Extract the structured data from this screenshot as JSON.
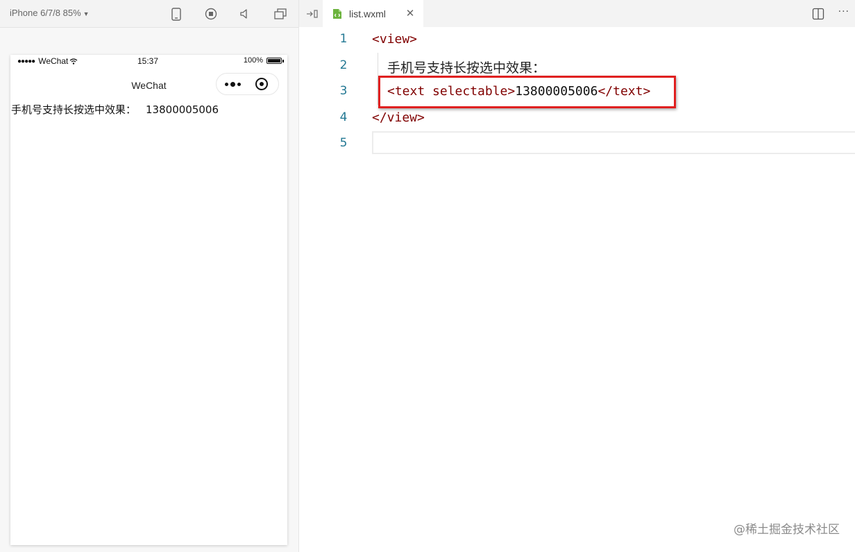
{
  "simulator": {
    "device_label": "iPhone 6/7/8 85%",
    "toolbar_icons": [
      "phone-icon",
      "record-icon",
      "speaker-icon",
      "window-icon"
    ],
    "status_bar": {
      "carrier": "WeChat",
      "time": "15:37",
      "battery": "100%",
      "battery_level": 1.0
    },
    "nav_title": "WeChat",
    "page": {
      "label": "手机号支持长按选中效果：",
      "number": "13800005006"
    }
  },
  "editor": {
    "tab": {
      "filename": "list.wxml"
    },
    "lines": [
      {
        "number": "1",
        "text": "<view>"
      },
      {
        "number": "2",
        "text": "手机号支持长按选中效果："
      },
      {
        "number": "3",
        "open": "<text selectable>",
        "content": "13800005006",
        "close": "</text>"
      },
      {
        "number": "4",
        "text": "</view>"
      },
      {
        "number": "5",
        "text": ""
      }
    ]
  },
  "watermark": "@稀土掘金技术社区",
  "colors": {
    "tag": "#800000",
    "line_number": "#237893",
    "highlight": "#e02020",
    "file_icon": "#6cb33e"
  }
}
